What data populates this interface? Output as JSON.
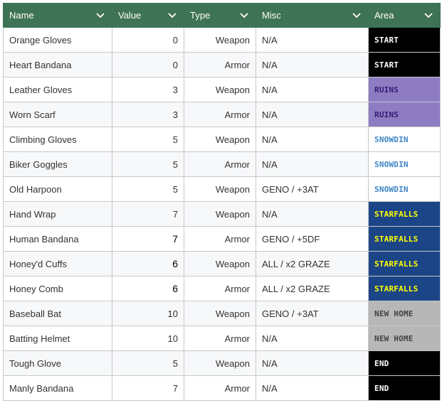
{
  "columns": [
    {
      "label": "Name"
    },
    {
      "label": "Value"
    },
    {
      "label": "Type"
    },
    {
      "label": "Misc"
    },
    {
      "label": "Area"
    }
  ],
  "area_styles": {
    "START": {
      "bg": "#000000",
      "fg": "#ffffff"
    },
    "RUINS": {
      "bg": "#8e7cc3",
      "fg": "#351c75"
    },
    "SNOWDIN": {
      "bg": "#ffffff",
      "fg": "#3d85c6"
    },
    "STARFALLS": {
      "bg": "#1c4587",
      "fg": "#ffff00"
    },
    "NEW HOME": {
      "bg": "#b7b7b7",
      "fg": "#434343"
    },
    "END": {
      "bg": "#000000",
      "fg": "#ffffff"
    }
  },
  "rows": [
    {
      "name": "Orange Gloves",
      "value": "0",
      "type": "Weapon",
      "misc": "N/A",
      "area": "START"
    },
    {
      "name": "Heart Bandana",
      "value": "0",
      "type": "Armor",
      "misc": "N/A",
      "area": "START"
    },
    {
      "name": "Leather Gloves",
      "value": "3",
      "type": "Weapon",
      "misc": "N/A",
      "area": "RUINS"
    },
    {
      "name": "Worn Scarf",
      "value": "3",
      "type": "Armor",
      "misc": "N/A",
      "area": "RUINS"
    },
    {
      "name": "Climbing Gloves",
      "value": "5",
      "type": "Weapon",
      "misc": "N/A",
      "area": "SNOWDIN"
    },
    {
      "name": "Biker Goggles",
      "value": "5",
      "type": "Armor",
      "misc": "N/A",
      "area": "SNOWDIN"
    },
    {
      "name": "Old Harpoon",
      "value": "5",
      "type": "Weapon",
      "misc": "GENO / +3AT",
      "area": "SNOWDIN"
    },
    {
      "name": "Hand Wrap",
      "value": "7",
      "type": "Weapon",
      "misc": "N/A",
      "area": "STARFALLS"
    },
    {
      "name": "Human Bandana",
      "value": "7",
      "type": "Armor",
      "misc": "GENO / +5DF",
      "area": "STARFALLS",
      "strong": true
    },
    {
      "name": "Honey'd Cuffs",
      "value": "6",
      "type": "Weapon",
      "misc": "ALL / x2 GRAZE",
      "area": "STARFALLS",
      "strong": true
    },
    {
      "name": "Honey Comb",
      "value": "6",
      "type": "Armor",
      "misc": "ALL / x2 GRAZE",
      "area": "STARFALLS",
      "strong": true
    },
    {
      "name": "Baseball Bat",
      "value": "10",
      "type": "Weapon",
      "misc": "GENO / +3AT",
      "area": "NEW HOME"
    },
    {
      "name": "Batting Helmet",
      "value": "10",
      "type": "Armor",
      "misc": "N/A",
      "area": "NEW HOME"
    },
    {
      "name": "Tough Glove",
      "value": "5",
      "type": "Weapon",
      "misc": "N/A",
      "area": "END"
    },
    {
      "name": "Manly Bandana",
      "value": "7",
      "type": "Armor",
      "misc": "N/A",
      "area": "END"
    }
  ]
}
